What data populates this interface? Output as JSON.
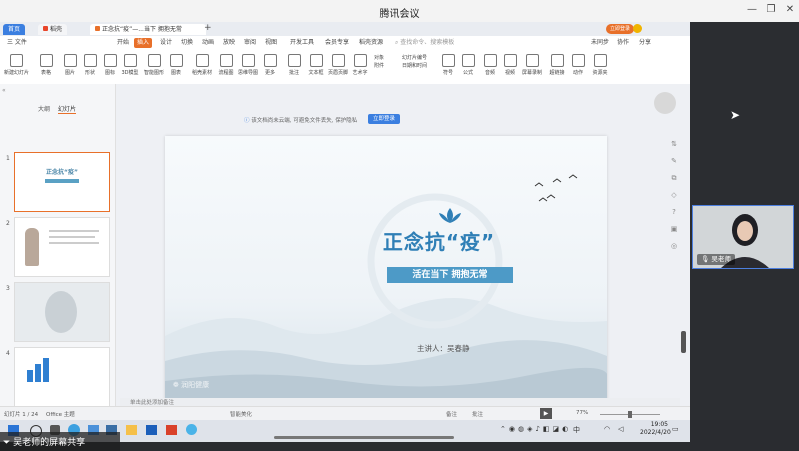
{
  "meeting": {
    "title": "腾讯会议",
    "minimize_icon": "—",
    "restore_icon": "❐",
    "close_icon": "✕"
  },
  "wps_tabs": {
    "home": "首页",
    "draft": "稻壳",
    "doc": "正念抗“疫”—...当下 拥抱无常",
    "new_tab": "+",
    "login_button": "立即登录"
  },
  "wps_menu": {
    "items": [
      "三 文件",
      "开始",
      "插入",
      "设计",
      "切换",
      "动画",
      "放映",
      "审阅",
      "视图",
      "开发工具",
      "会员专享",
      "稻壳资源"
    ],
    "search_placeholder": "查找命令、搜索模板",
    "right": [
      "未同步",
      "协作",
      "分享"
    ]
  },
  "ribbon": {
    "buttons": [
      "新建幻灯片",
      "表格",
      "图片",
      "形状",
      "图标",
      "3D模型",
      "智能图形",
      "图表",
      "稻壳素材",
      "流程图",
      "思维导图",
      "更多",
      "批注",
      "文本框",
      "页眉页脚",
      "艺术字",
      "对象",
      "幻灯片编号",
      "附件",
      "日期和时间",
      "符号",
      "公式",
      "音频",
      "视频",
      "屏幕录制",
      "超链接",
      "动作",
      "资源夹"
    ]
  },
  "panel": {
    "tab_outline": "大纲",
    "tab_slides": "幻灯片",
    "thumb_nums": [
      "1",
      "2",
      "3",
      "4"
    ],
    "thumb1_title": "正念抗“疫”",
    "add": "+"
  },
  "cloud_notice": {
    "text": "该文档尚未云端, 可避免文件丢失, 保护隐私",
    "button": "立即登录"
  },
  "slide": {
    "title": "正念抗“疫”",
    "subtitle": "活在当下   拥抱无常",
    "speaker": "主讲人：吴春静",
    "brand": "润阳健康"
  },
  "status": {
    "slide_info": "幻灯片 1 / 24",
    "theme": "Office 主题",
    "notes_placeholder": "单击此处添加备注",
    "smart_beautify": "智能美化",
    "notes": "备注",
    "comments": "批注",
    "zoom": "77%"
  },
  "video": {
    "name": "吴老师"
  },
  "taskbar": {
    "time": "19:05",
    "date": "2022/4/20",
    "lang": "中"
  },
  "share_label": "吴老师的屏幕共享"
}
